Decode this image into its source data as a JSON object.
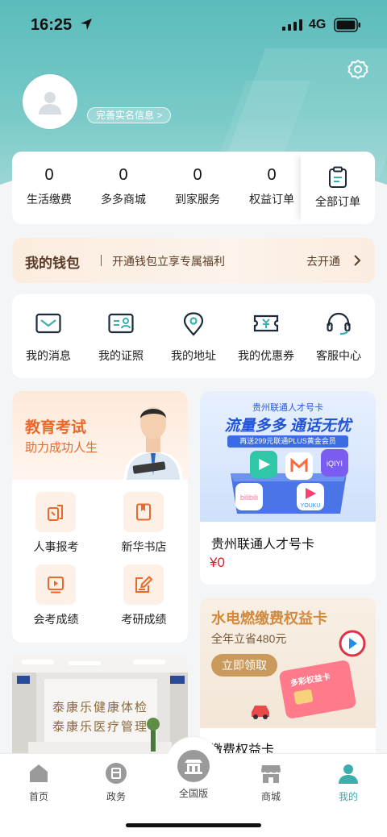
{
  "status_bar": {
    "time": "16:25",
    "network": "4G"
  },
  "profile": {
    "realname_link": "完善实名信息 >"
  },
  "orders": {
    "items": [
      {
        "count": "0",
        "label": "生活缴费"
      },
      {
        "count": "0",
        "label": "多多商城"
      },
      {
        "count": "0",
        "label": "到家服务"
      },
      {
        "count": "0",
        "label": "权益订单"
      }
    ],
    "all_label": "全部订单"
  },
  "wallet": {
    "title": "我的钱包",
    "desc": "开通钱包立享专属福利",
    "action": "去开通"
  },
  "services": [
    {
      "label": "我的消息",
      "icon": "mail-icon"
    },
    {
      "label": "我的证照",
      "icon": "id-card-icon"
    },
    {
      "label": "我的地址",
      "icon": "location-icon"
    },
    {
      "label": "我的优惠券",
      "icon": "coupon-icon"
    },
    {
      "label": "客服中心",
      "icon": "headset-icon"
    }
  ],
  "education": {
    "title": "教育考试",
    "subtitle": "助力成功人生",
    "items": [
      {
        "label": "人事报考",
        "icon": "exam-register-icon"
      },
      {
        "label": "新华书店",
        "icon": "book-icon"
      },
      {
        "label": "会考成绩",
        "icon": "video-icon"
      },
      {
        "label": "考研成绩",
        "icon": "edit-icon"
      }
    ]
  },
  "talent_card": {
    "banner_top": "贵州联通人才号卡",
    "banner_main": "流量多多 通话无忧",
    "banner_strip": "再送299元联通PLUS黄金会员",
    "title": "贵州联通人才号卡",
    "price": "¥0"
  },
  "utility_card": {
    "title": "水电燃缴费权益卡",
    "subtitle": "全年立省480元",
    "button": "立即领取",
    "card_text": "多彩权益卡",
    "name": "缴费权益卡"
  },
  "photo": {
    "sign_line1": "泰康乐健康体检",
    "sign_line2": "泰康乐医疗管理"
  },
  "tabbar": [
    {
      "label": "首页",
      "icon": "home-icon"
    },
    {
      "label": "政务",
      "icon": "government-icon"
    },
    {
      "label": "全国版",
      "icon": "national-icon"
    },
    {
      "label": "商城",
      "icon": "store-icon"
    },
    {
      "label": "我的",
      "icon": "profile-icon",
      "active": true
    }
  ],
  "colors": {
    "accent": "#3aafac",
    "header": "#5bbcbb",
    "wallet_text": "#5a3c28",
    "education": "#e8692b",
    "price": "#e0182b"
  }
}
